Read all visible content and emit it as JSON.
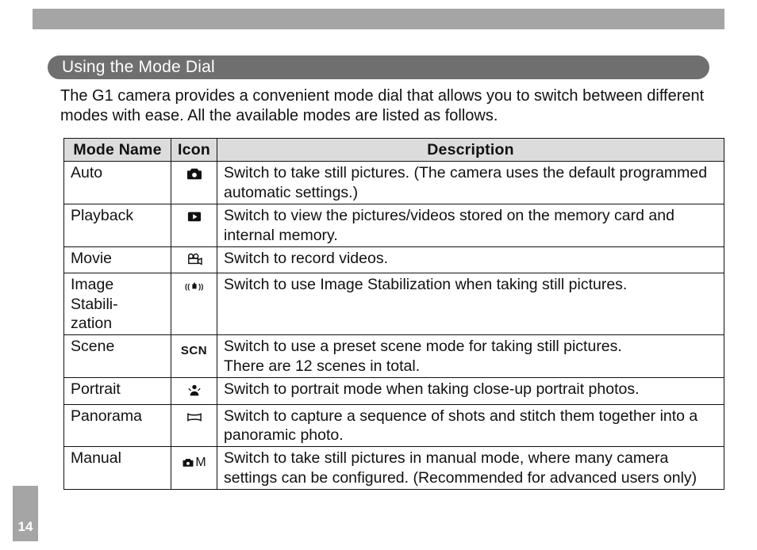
{
  "page": {
    "number": "14",
    "section_title": "Using the Mode Dial",
    "intro": "The G1 camera provides a convenient mode dial that allows you to switch between different modes with ease.  All the available modes are listed as follows."
  },
  "table": {
    "headers": {
      "mode_name": "Mode Name",
      "icon": "Icon",
      "description": "Description"
    },
    "rows": [
      {
        "name": "Auto",
        "icon": "camera",
        "description": "Switch to take still pictures. (The camera uses the default programmed automatic  settings.)"
      },
      {
        "name": "Playback",
        "icon": "playback",
        "description": "Switch to view the pictures/videos stored on the memory card and internal memory."
      },
      {
        "name": "Movie",
        "icon": "movie",
        "description": "Switch to record videos."
      },
      {
        "name": "Image Stabilization",
        "icon": "stabilize",
        "description": "Switch to use Image Stabilization when taking still pictures."
      },
      {
        "name": "Scene",
        "icon": "scn",
        "description": "Switch to use a preset scene mode for taking still pictures.\nThere are 12 scenes in total."
      },
      {
        "name": "Portrait",
        "icon": "portrait",
        "description": "Switch to portrait mode when taking close-up portrait photos."
      },
      {
        "name": "Panorama",
        "icon": "panorama",
        "description": "Switch to capture a sequence of shots and stitch them together into a panoramic photo."
      },
      {
        "name": "Manual",
        "icon": "manual",
        "description": "Switch to take still pictures in manual mode, where many camera settings can be configured. (Recommended for advanced users only)"
      }
    ]
  },
  "icons": {
    "camera": "camera-icon",
    "playback": "playback-icon",
    "movie": "movie-camera-icon",
    "stabilize": "image-stabilization-icon",
    "scn": "scn-text-icon",
    "portrait": "portrait-person-icon",
    "panorama": "panorama-icon",
    "manual": "camera-m-icon"
  }
}
